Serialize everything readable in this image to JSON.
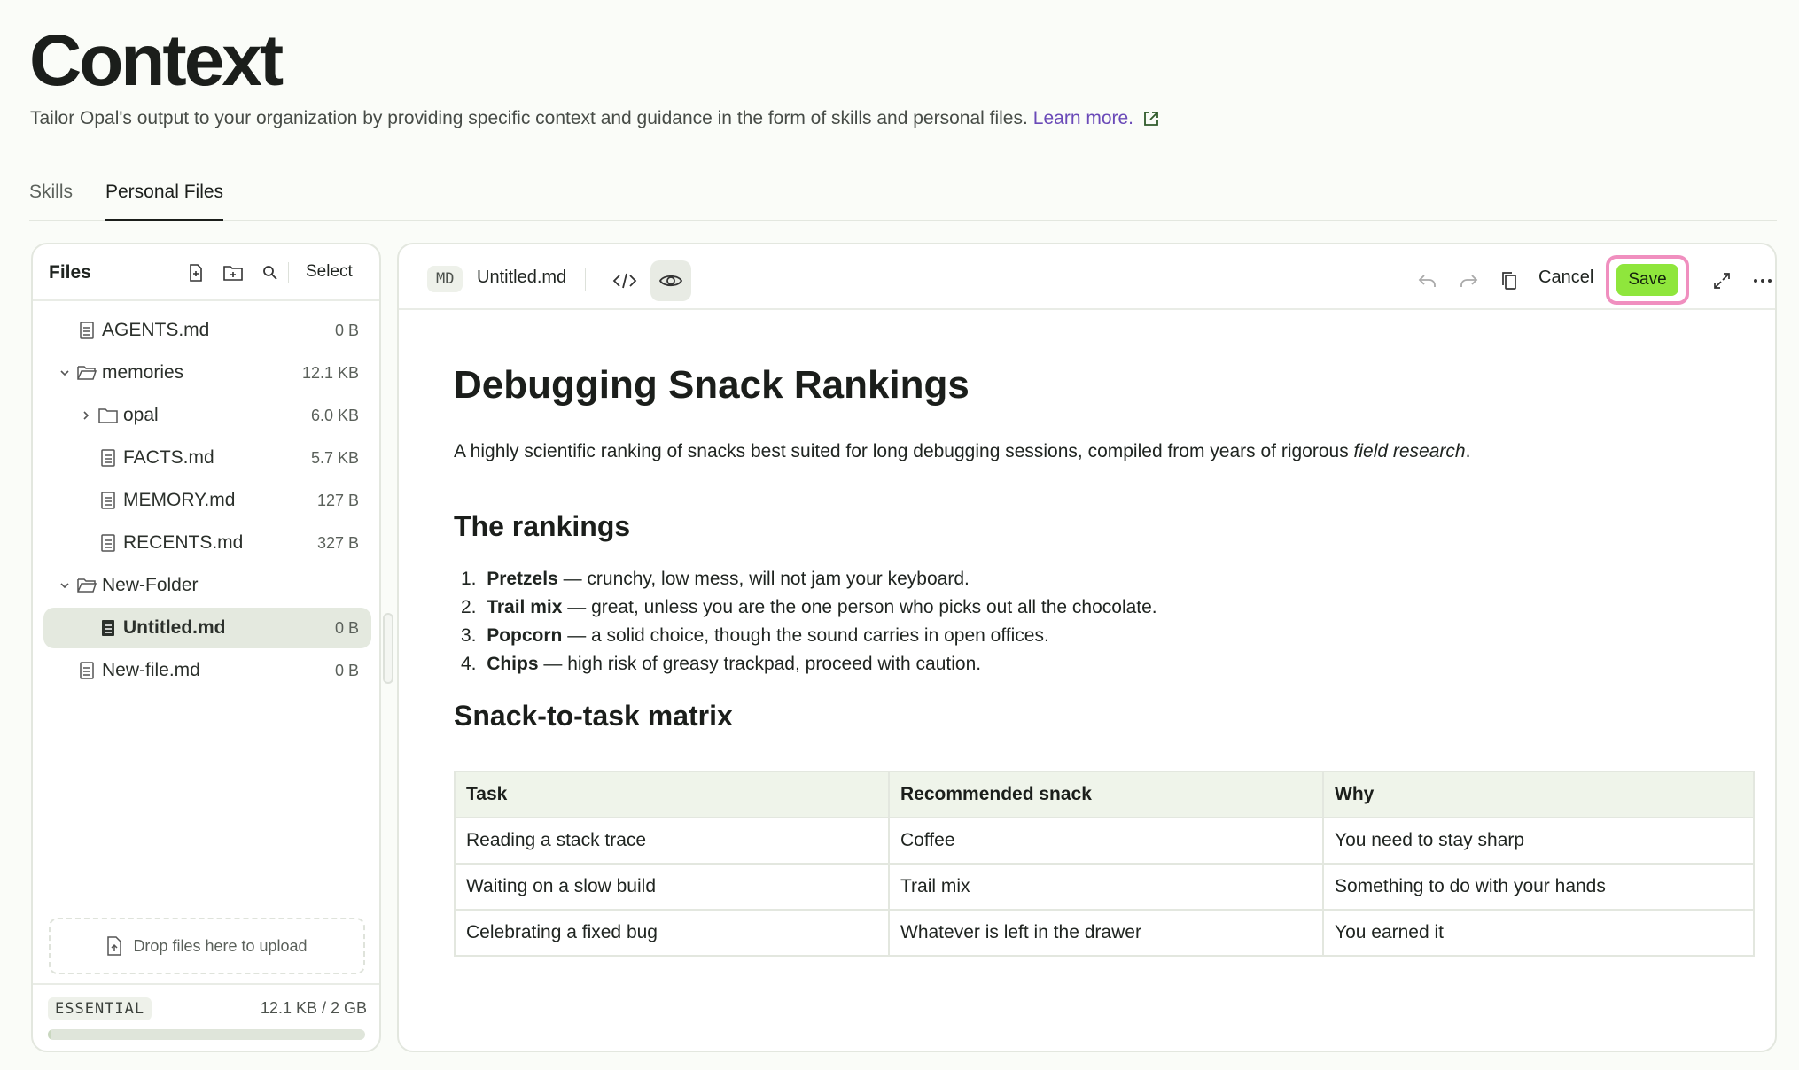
{
  "header": {
    "title": "Context",
    "subtitle": "Tailor Opal's output to your organization by providing specific context and guidance in the form of skills and personal files.",
    "learn_more": "Learn more."
  },
  "tabs": [
    {
      "label": "Skills",
      "active": false
    },
    {
      "label": "Personal Files",
      "active": true
    }
  ],
  "files": {
    "title": "Files",
    "select_label": "Select",
    "tree": [
      {
        "name": "AGENTS.md",
        "size": "0 B",
        "type": "file",
        "depth": 0,
        "selected": false
      },
      {
        "name": "memories",
        "size": "12.1 KB",
        "type": "folder",
        "depth": 0,
        "expanded": true,
        "selected": false
      },
      {
        "name": "opal",
        "size": "6.0 KB",
        "type": "folder",
        "depth": 1,
        "expanded": false,
        "selected": false
      },
      {
        "name": "FACTS.md",
        "size": "5.7 KB",
        "type": "file",
        "depth": 1,
        "selected": false
      },
      {
        "name": "MEMORY.md",
        "size": "127 B",
        "type": "file",
        "depth": 1,
        "selected": false
      },
      {
        "name": "RECENTS.md",
        "size": "327 B",
        "type": "file",
        "depth": 1,
        "selected": false
      },
      {
        "name": "New-Folder",
        "size": "",
        "type": "folder",
        "depth": 0,
        "expanded": true,
        "selected": false
      },
      {
        "name": "Untitled.md",
        "size": "0 B",
        "type": "file",
        "depth": 1,
        "selected": true
      },
      {
        "name": "New-file.md",
        "size": "0 B",
        "type": "file",
        "depth": 0,
        "selected": false
      }
    ],
    "drop_zone": "Drop files here to upload",
    "plan": "ESSENTIAL",
    "usage": "12.1 KB / 2 GB",
    "usage_fraction": 0.01
  },
  "editor": {
    "format_badge": "MD",
    "file_name": "Untitled.md",
    "cancel_label": "Cancel",
    "save_label": "Save"
  },
  "document": {
    "title": "Debugging Snack Rankings",
    "intro_plain": "A highly scientific ranking of snacks best suited for long debugging sessions, compiled from years of rigorous ",
    "intro_italic": "field research",
    "intro_end": ".",
    "rankings_heading": "The rankings",
    "rankings": [
      {
        "num": "1.",
        "name": "Pretzels",
        "desc": " — crunchy, low mess, will not jam your keyboard."
      },
      {
        "num": "2.",
        "name": "Trail mix",
        "desc": " — great, unless you are the one person who picks out all the chocolate."
      },
      {
        "num": "3.",
        "name": "Popcorn",
        "desc": " — a solid choice, though the sound carries in open offices."
      },
      {
        "num": "4.",
        "name": "Chips",
        "desc": " — high risk of greasy trackpad, proceed with caution."
      }
    ],
    "matrix_heading": "Snack-to-task matrix",
    "matrix": {
      "headers": [
        "Task",
        "Recommended snack",
        "Why"
      ],
      "rows": [
        [
          "Reading a stack trace",
          "Coffee",
          "You need to stay sharp"
        ],
        [
          "Waiting on a slow build",
          "Trail mix",
          "Something to do with your hands"
        ],
        [
          "Celebrating a fixed bug",
          "Whatever is left in the drawer",
          "You earned it"
        ]
      ]
    }
  }
}
